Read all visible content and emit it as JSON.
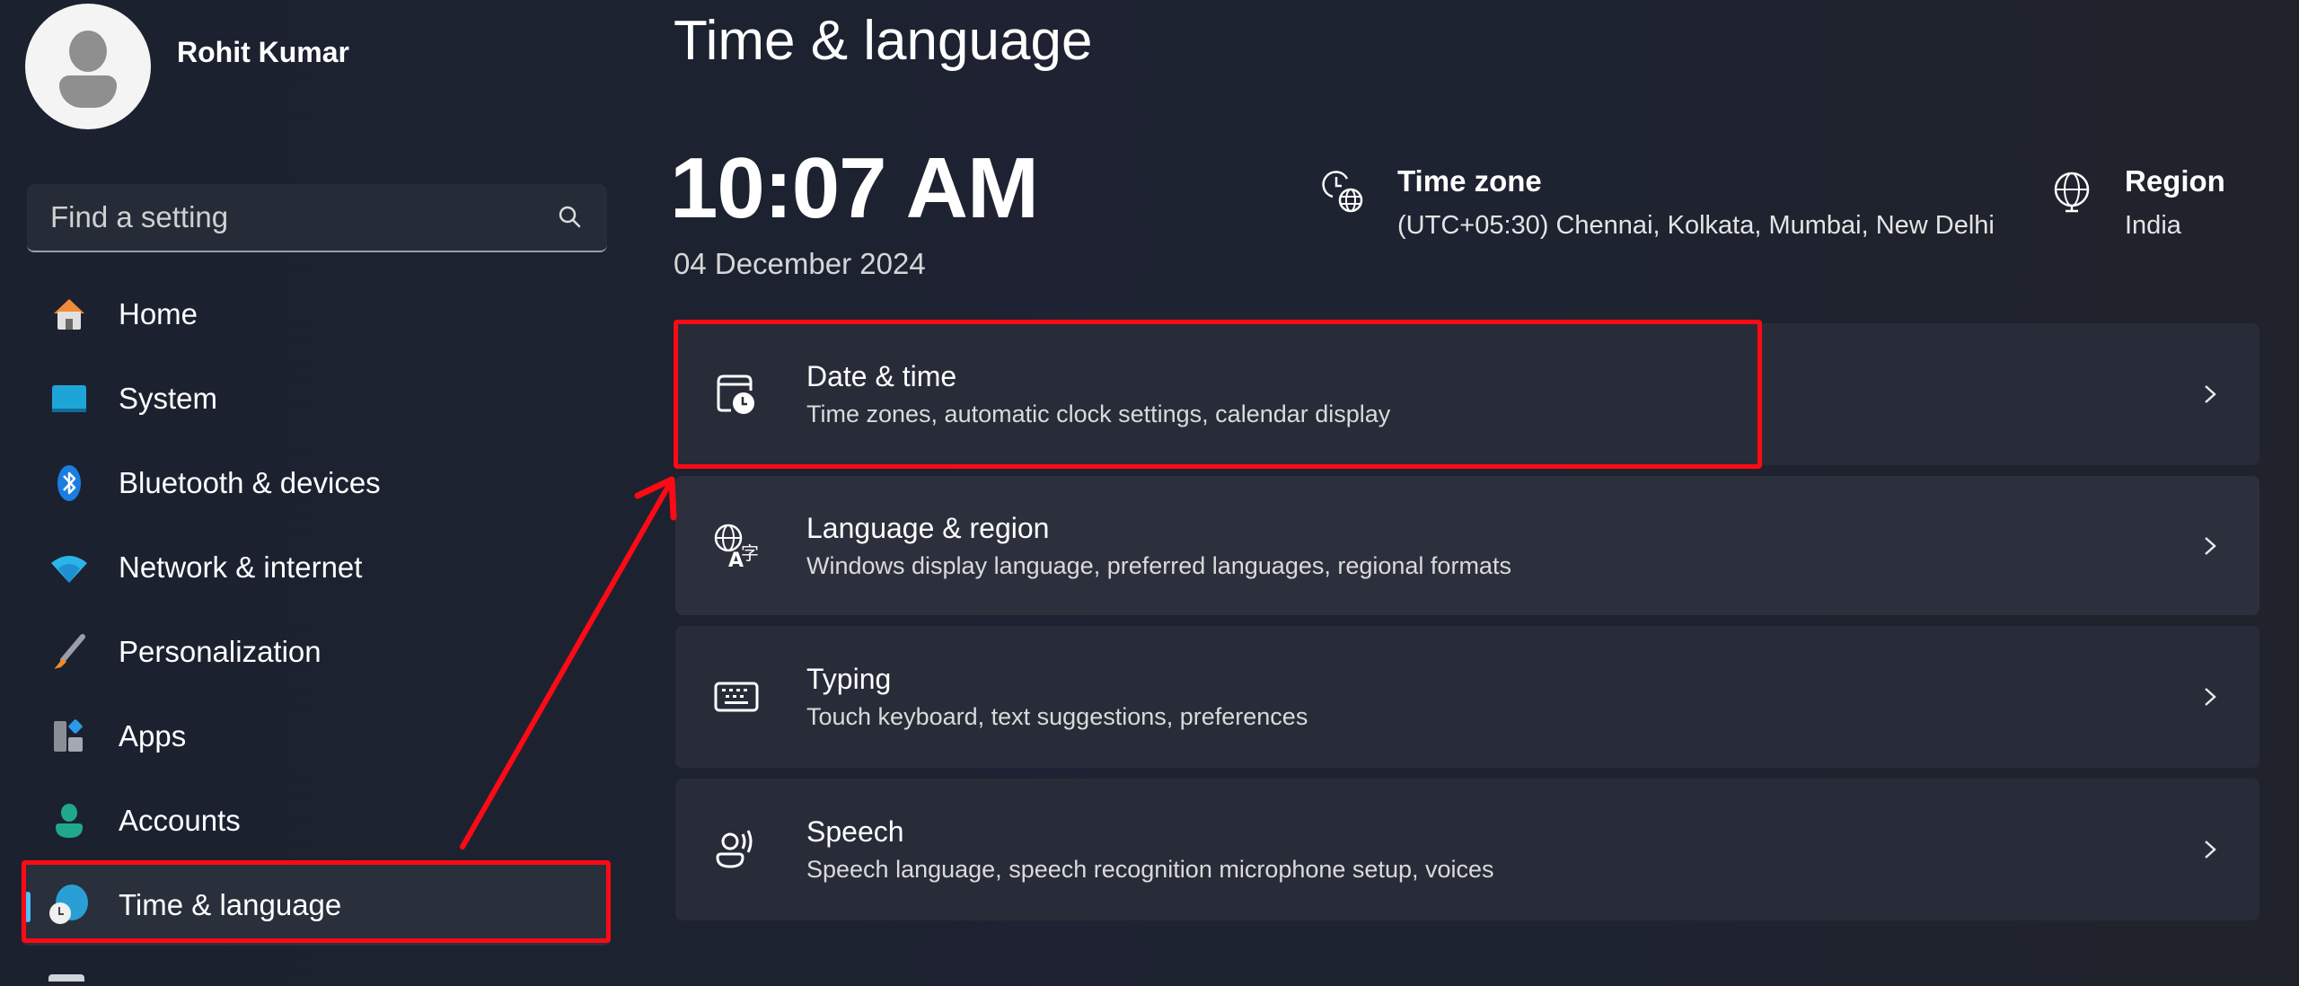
{
  "user": {
    "name": "Rohit Kumar"
  },
  "search": {
    "placeholder": "Find a setting",
    "value": ""
  },
  "sidebar": {
    "items": [
      {
        "label": "Home",
        "icon": "home-icon"
      },
      {
        "label": "System",
        "icon": "system-icon"
      },
      {
        "label": "Bluetooth & devices",
        "icon": "bluetooth-icon"
      },
      {
        "label": "Network & internet",
        "icon": "wifi-icon"
      },
      {
        "label": "Personalization",
        "icon": "brush-icon"
      },
      {
        "label": "Apps",
        "icon": "apps-icon"
      },
      {
        "label": "Accounts",
        "icon": "accounts-icon"
      },
      {
        "label": "Time & language",
        "icon": "time-language-icon",
        "active": true
      }
    ]
  },
  "main": {
    "title": "Time & language",
    "time": "10:07 AM",
    "date": "04 December 2024",
    "time_zone": {
      "title": "Time zone",
      "value": "(UTC+05:30) Chennai, Kolkata, Mumbai, New Delhi"
    },
    "region": {
      "title": "Region",
      "value": "India"
    },
    "cards": [
      {
        "title": "Date & time",
        "desc": "Time zones, automatic clock settings, calendar display",
        "icon": "calendar-clock-icon"
      },
      {
        "title": "Language & region",
        "desc": "Windows display language, preferred languages, regional formats",
        "icon": "language-icon"
      },
      {
        "title": "Typing",
        "desc": "Touch keyboard, text suggestions, preferences",
        "icon": "keyboard-icon"
      },
      {
        "title": "Speech",
        "desc": "Speech language, speech recognition microphone setup, voices",
        "icon": "speech-icon"
      }
    ]
  },
  "annotation": {
    "color": "#ff0a14"
  },
  "colors": {
    "accent": "#4cc2ff",
    "background": "#1d2230",
    "card": "#272c38"
  }
}
